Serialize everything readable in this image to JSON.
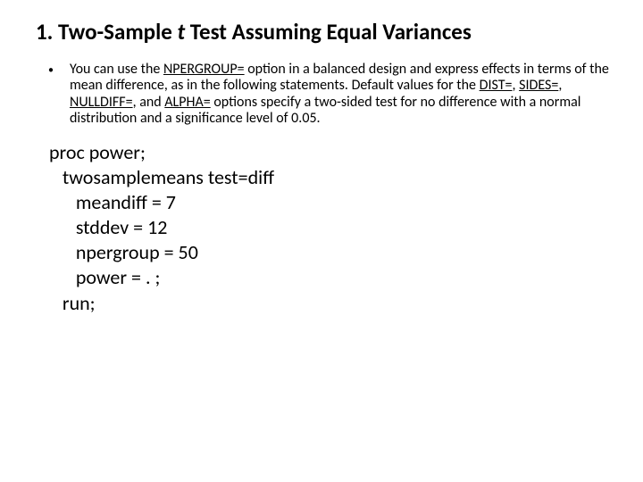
{
  "title": {
    "prefix": "1. Two-Sample ",
    "italic": "t",
    "suffix": " Test Assuming Equal Variances"
  },
  "bullet": {
    "marker": "•",
    "t1": "You can use the ",
    "link1": "NPERGROUP=",
    "t2": " option in a balanced design and express effects in terms of the mean difference, as in the following statements. Default values for the ",
    "link2": "DIST=",
    "t3": ", ",
    "link3": "SIDES=",
    "t4": ", ",
    "link4": "NULLDIFF=",
    "t5": ", and ",
    "link5": "ALPHA=",
    "t6": " options specify a two-sided test for no difference with a normal distribution and a significance level of 0.05."
  },
  "code": {
    "l1": " proc power;",
    "l2": "    twosamplemeans test=diff",
    "l3": "       meandiff = 7",
    "l4": "       stddev = 12",
    "l5": "       npergroup = 50",
    "l6": "       power = . ;",
    "l7": "    run;"
  }
}
